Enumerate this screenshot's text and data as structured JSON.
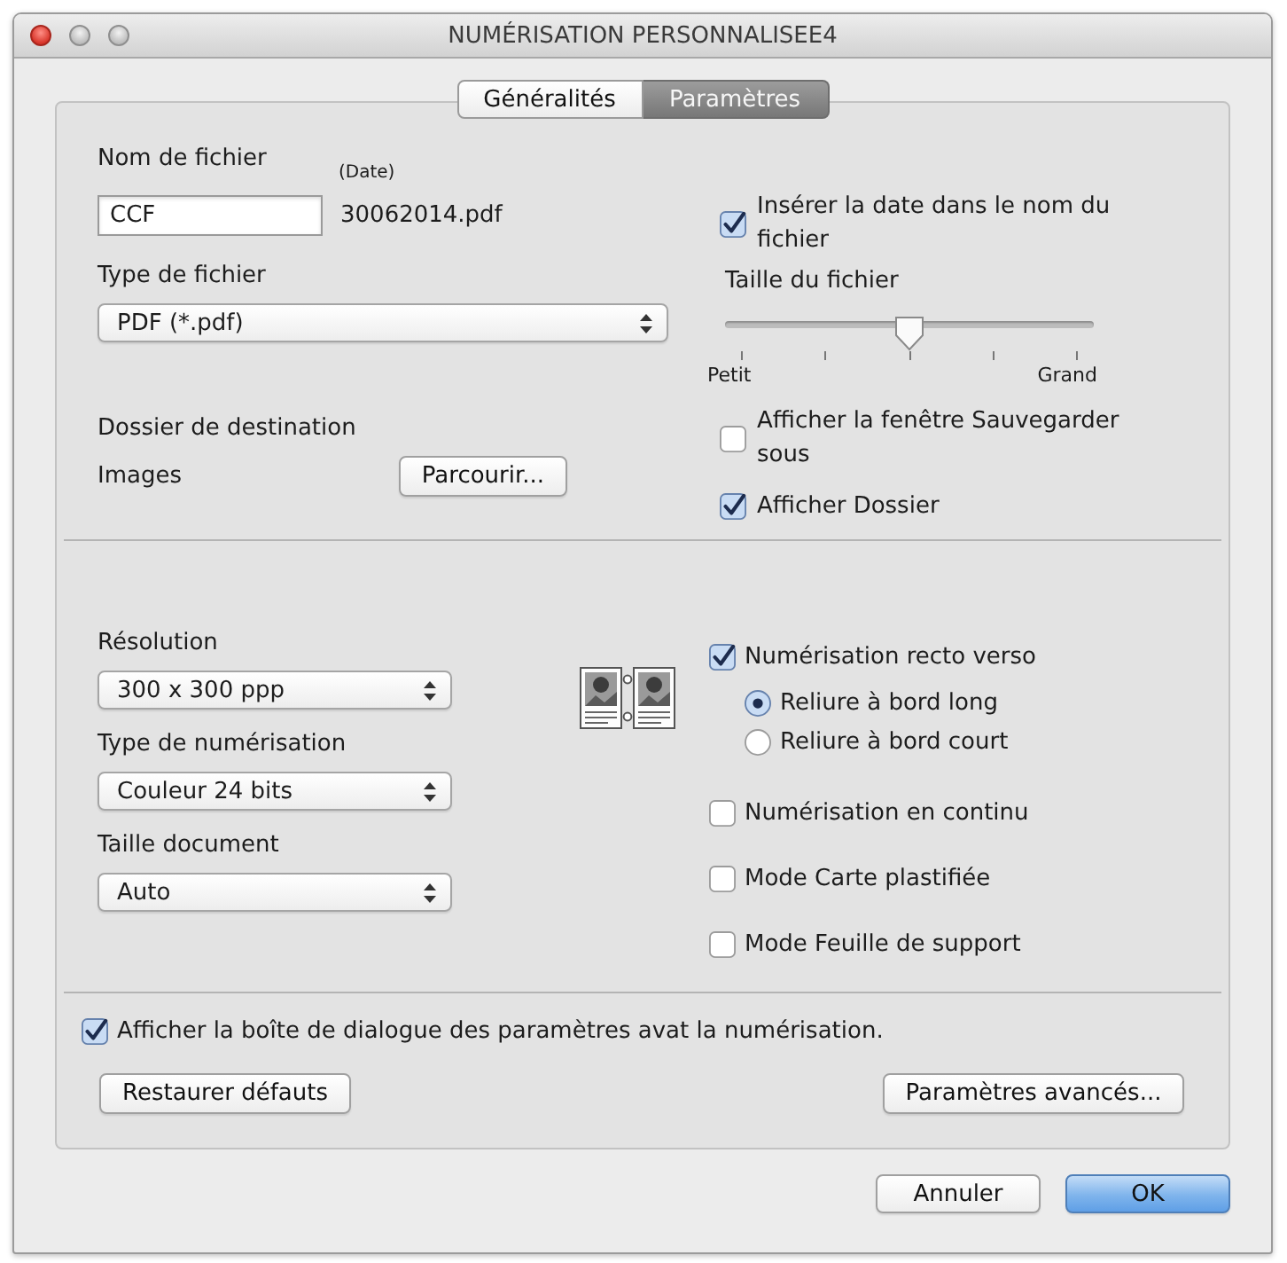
{
  "window": {
    "title": "NUMÉRISATION PERSONNALISEE4"
  },
  "tabs": [
    {
      "label": "Généralités",
      "selected": false
    },
    {
      "label": "Paramètres",
      "selected": true
    }
  ],
  "file_section": {
    "name_label": "Nom de fichier",
    "date_label": "(Date)",
    "name_value": "CCF",
    "date_value": "30062014.pdf",
    "type_label": "Type de fichier",
    "type_value": "PDF (*.pdf)",
    "folder_label": "Dossier de destination",
    "folder_value": "Images",
    "browse_button": "Parcourir..."
  },
  "file_options": [
    {
      "kind": "checkbox",
      "label": "Insérer la date dans le nom du fichier",
      "checked": true
    },
    {
      "kind": "slider",
      "label": "Taille du fichier",
      "level": 0.5,
      "min_label": "Petit",
      "max_label": "Grand"
    },
    {
      "kind": "checkbox",
      "label": "Afficher la fenêtre Sauvegarder sous",
      "checked": false
    },
    {
      "kind": "checkbox",
      "label": "Afficher Dossier",
      "checked": true
    }
  ],
  "scan_settings": [
    {
      "label": "Résolution",
      "value": "300 x 300 ppp"
    },
    {
      "label": "Type de numérisation",
      "value": "Couleur 24 bits"
    },
    {
      "label": "Taille document",
      "value": "Auto"
    }
  ],
  "duplex": {
    "label": "Numérisation recto verso",
    "checked": true,
    "binding": [
      {
        "label": "Reliure à bord long",
        "selected": true
      },
      {
        "label": "Reliure à bord court",
        "selected": false
      }
    ]
  },
  "scan_modes": [
    {
      "label": "Numérisation en continu",
      "checked": false
    },
    {
      "label": "Mode Carte plastifiée",
      "checked": false
    },
    {
      "label": "Mode Feuille de support",
      "checked": false
    }
  ],
  "show_dialog": {
    "label": "Afficher la boîte de dialogue des paramètres avat la numérisation.",
    "checked": true
  },
  "restore_button": "Restaurer défauts",
  "advanced_button": "Paramètres avancés...",
  "dialog_buttons": [
    {
      "label": "Annuler",
      "kind": "cancel"
    },
    {
      "label": "OK",
      "kind": "default"
    }
  ]
}
